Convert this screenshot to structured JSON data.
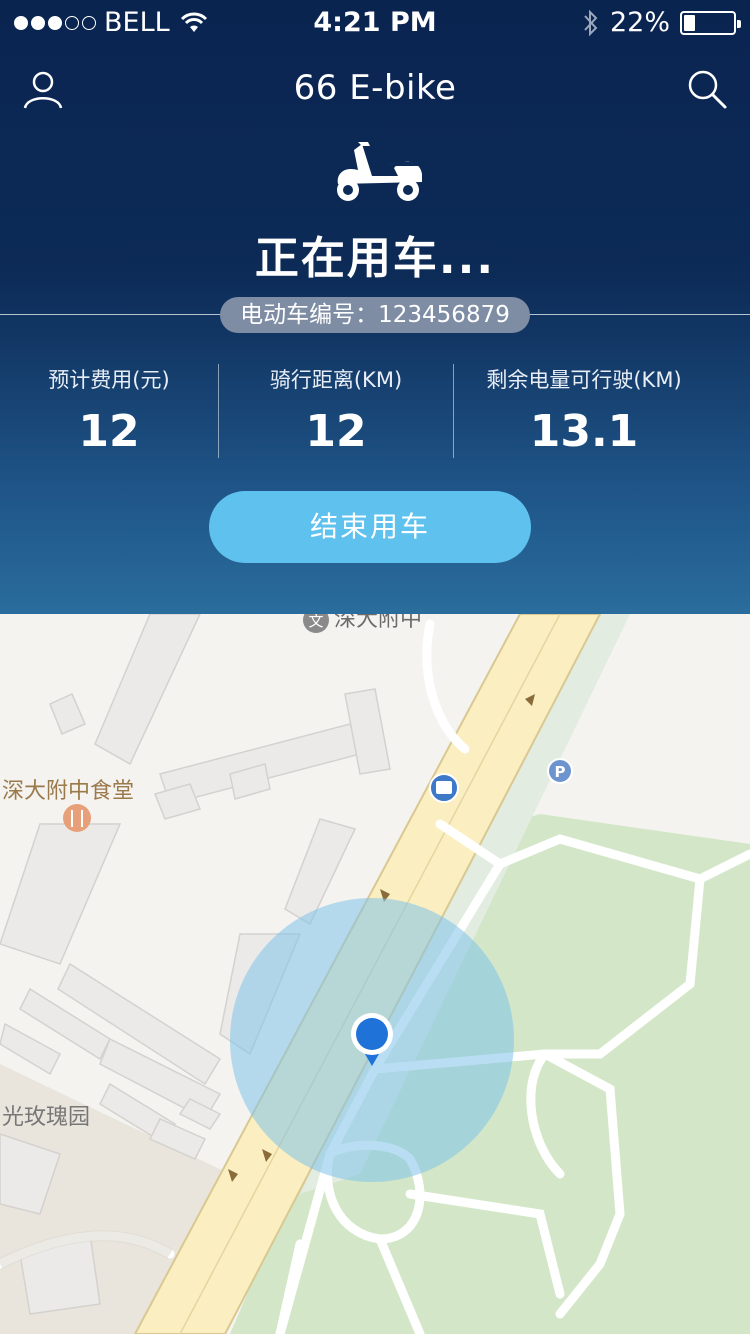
{
  "status_bar": {
    "carrier": "BELL",
    "time": "4:21 PM",
    "battery_percent": "22%",
    "battery_level": 0.22,
    "signal_bars": 3
  },
  "nav": {
    "title": "66 E-bike",
    "user_icon": "user-icon",
    "search_icon": "search-icon"
  },
  "ride": {
    "vehicle_icon": "scooter-icon",
    "status_text": "正在用车...",
    "vehicle_id_label": "电动车编号：123456879"
  },
  "stats": [
    {
      "label": "预计费用(元)",
      "value": "12"
    },
    {
      "label": "骑行距离(KM)",
      "value": "12"
    },
    {
      "label": "剩余电量可行驶(KM)",
      "value": "13.1"
    }
  ],
  "actions": {
    "end_ride": "结束用车"
  },
  "map": {
    "labels": {
      "school": "深大附中",
      "canteen": "深大附中食堂",
      "garden": "光玫瑰园"
    },
    "icons": [
      "school-icon",
      "restaurant-icon",
      "bus-stop-icon",
      "parking-icon",
      "location-pin-icon"
    ]
  },
  "colors": {
    "header_top": "#0a2450",
    "header_bottom": "#2a6d9d",
    "accent": "#5ec1ee",
    "pill": "#7e8da4",
    "park": "#d3e7c8",
    "road": "#fbefc2",
    "location": "#1f73d8"
  }
}
